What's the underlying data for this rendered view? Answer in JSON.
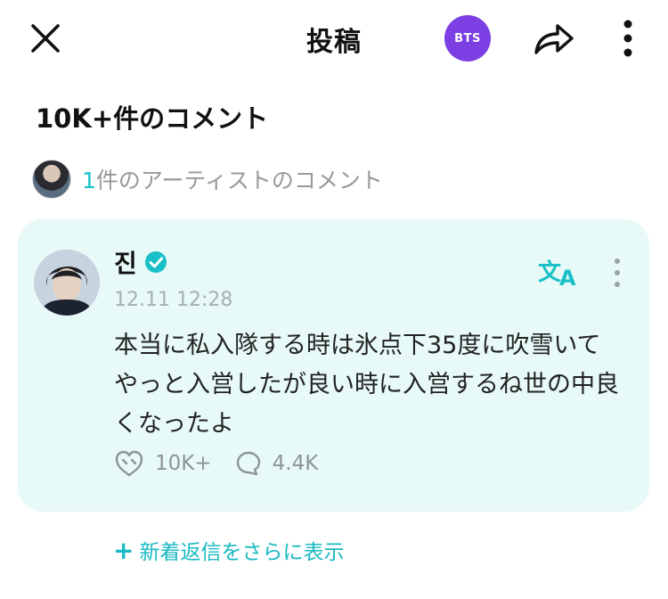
{
  "header": {
    "title": "投稿",
    "community_badge": "BTS",
    "close_icon": "close-icon",
    "share_icon": "share-icon",
    "more_icon": "more-vertical-icon"
  },
  "comments": {
    "count_label": "10K+件のコメント",
    "artist_count": "1",
    "artist_label": "件のアーティストのコメント"
  },
  "comment": {
    "author": "진",
    "timestamp": "12.11 12:28",
    "body": "本当に私入隊する時は氷点下35度に吹雪いてやっと入営したが良い時に入営するね世の中良くなったよ",
    "likes": "10K+",
    "replies": "4.4K"
  },
  "more_replies_label": "新着返信をさらに表示",
  "colors": {
    "accent": "#19c0c9",
    "badge": "#7b3fe4",
    "card_bg": "#e7faf8"
  }
}
